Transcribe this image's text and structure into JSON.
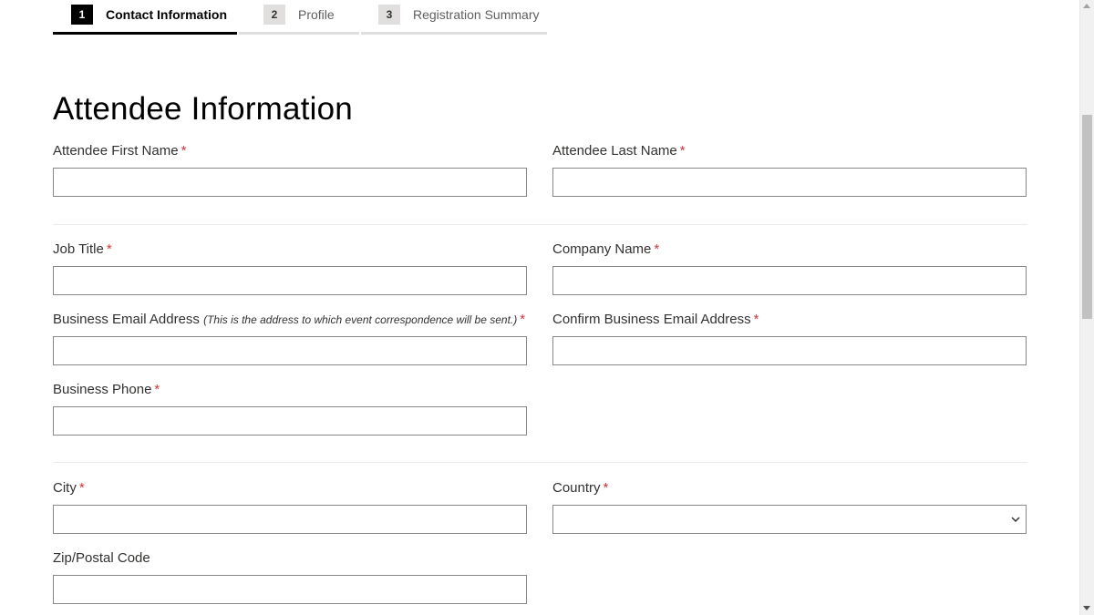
{
  "stepper": {
    "steps": [
      {
        "number": "1",
        "label": "Contact Information",
        "active": true
      },
      {
        "number": "2",
        "label": "Profile",
        "active": false
      },
      {
        "number": "3",
        "label": "Registration Summary",
        "active": false
      }
    ]
  },
  "heading": "Attendee Information",
  "required_marker": "*",
  "fields": {
    "first_name": {
      "label": "Attendee First Name",
      "value": ""
    },
    "last_name": {
      "label": "Attendee Last Name",
      "value": ""
    },
    "job_title": {
      "label": "Job Title",
      "value": ""
    },
    "company_name": {
      "label": "Company Name",
      "value": ""
    },
    "business_email": {
      "label": "Business Email Address",
      "note": "(This is the address to which event correspondence will be sent.)",
      "value": ""
    },
    "confirm_email": {
      "label": "Confirm Business Email Address",
      "value": ""
    },
    "business_phone": {
      "label": "Business Phone",
      "value": ""
    },
    "city": {
      "label": "City",
      "value": ""
    },
    "country": {
      "label": "Country",
      "value": ""
    },
    "zip": {
      "label": "Zip/Postal Code",
      "value": ""
    }
  },
  "colors": {
    "required": "#d13438",
    "active_step": "#000000",
    "inactive_step": "#e1dfdd",
    "input_border": "#8a8886"
  },
  "icons": {
    "select": "chevron-down-icon",
    "scroll_up": "scroll-up-arrow-icon",
    "scroll_down": "scroll-down-arrow-icon"
  }
}
